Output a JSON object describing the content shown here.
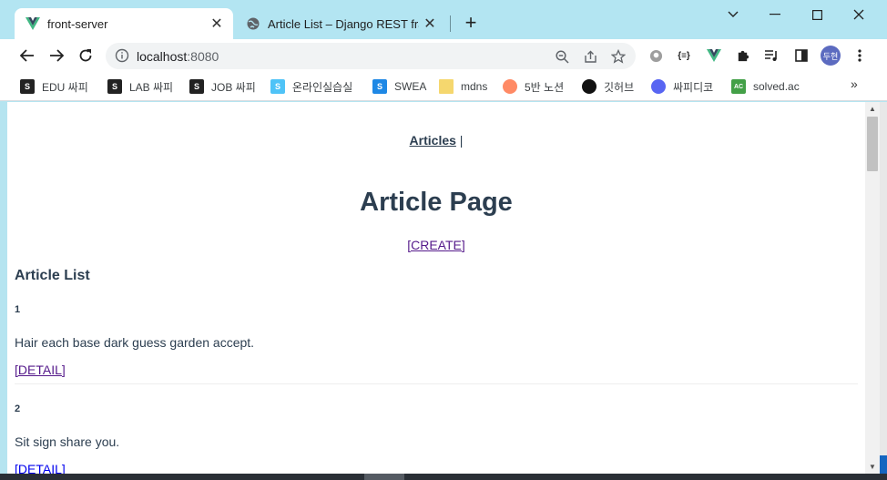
{
  "browser": {
    "tabs": [
      {
        "title": "front-server",
        "active": true,
        "icon": "vue-icon"
      },
      {
        "title": "Article List – Django REST frame",
        "active": false,
        "icon": "globe-icon"
      }
    ],
    "url": {
      "host": "localhost",
      "port": ":8080"
    },
    "profile_label": "두현",
    "bookmarks": [
      {
        "label": "EDU 싸피",
        "icon": "ssafy-icon",
        "color": "#222222"
      },
      {
        "label": "LAB 싸피",
        "icon": "ssafy-icon",
        "color": "#222222"
      },
      {
        "label": "JOB 싸피",
        "icon": "ssafy-icon",
        "color": "#222222"
      },
      {
        "label": "온라인실습실",
        "icon": "ssafy-blue-icon",
        "color": "#4fc3f7"
      },
      {
        "label": "SWEA",
        "icon": "swea-icon",
        "color": "#1e88e5"
      },
      {
        "label": "mdns",
        "icon": "folder-icon",
        "color": "#f5d76e"
      },
      {
        "label": "5반 노션",
        "icon": "peach-icon",
        "color": "#ff8a65"
      },
      {
        "label": "깃허브",
        "icon": "github-icon",
        "color": "#111111"
      },
      {
        "label": "싸피디코",
        "icon": "discord-icon",
        "color": "#5865f2"
      },
      {
        "label": "solved.ac",
        "icon": "solvedac-icon",
        "color": "#43a047"
      }
    ],
    "bookmark_more": "»"
  },
  "page": {
    "nav_link": "Articles",
    "nav_sep": "|",
    "heading": "Article Page",
    "create_link": "[CREATE]",
    "list_heading": "Article List",
    "articles": [
      {
        "id": "1",
        "content": "Hair each base dark guess garden accept.",
        "detail": "[DETAIL]",
        "detail_color": "#551a8b"
      },
      {
        "id": "2",
        "content": "Sit sign share you.",
        "detail": "[DETAIL]",
        "detail_color": "#0000ee"
      }
    ]
  },
  "colors": {
    "accent_tabstrip": "#b3e5f2",
    "text": "#2c3e50",
    "visited_link": "#551a8b",
    "link": "#0000ee"
  }
}
